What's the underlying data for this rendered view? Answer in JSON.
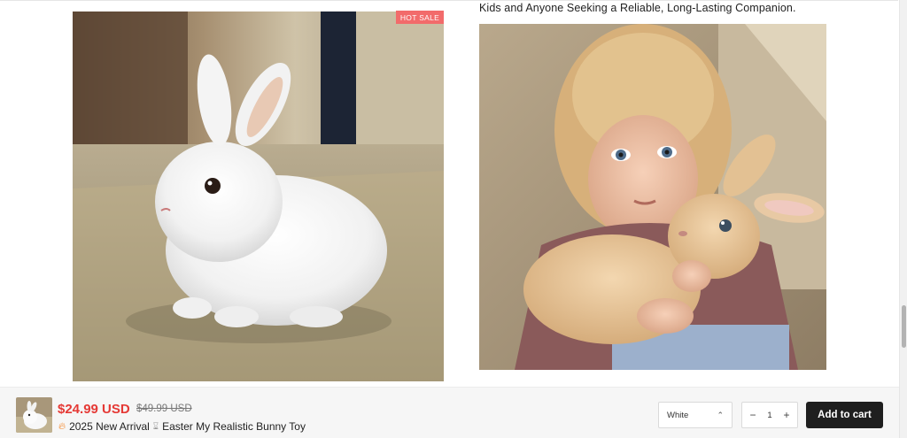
{
  "badges": {
    "hot_sale": "HOT SALE"
  },
  "description": {
    "line": "Kids and Anyone Seeking a Reliable, Long-Lasting Companion."
  },
  "sticky_cart": {
    "price": "$24.99 USD",
    "compare_price": "$49.99 USD",
    "title": "2025 New Arrival",
    "title_product": "Easter My Realistic Bunny Toy",
    "variant": "White",
    "quantity": "1",
    "minus": "−",
    "plus": "+",
    "add_to_cart": "Add to cart"
  },
  "colors": {
    "sale_red": "#e53935",
    "badge": "#f26b6b",
    "button": "#1f1f1f"
  },
  "icons": {
    "title_left": "fire-icon",
    "title_mid": "hourglass-icon",
    "select": "chevron-up-icon"
  }
}
